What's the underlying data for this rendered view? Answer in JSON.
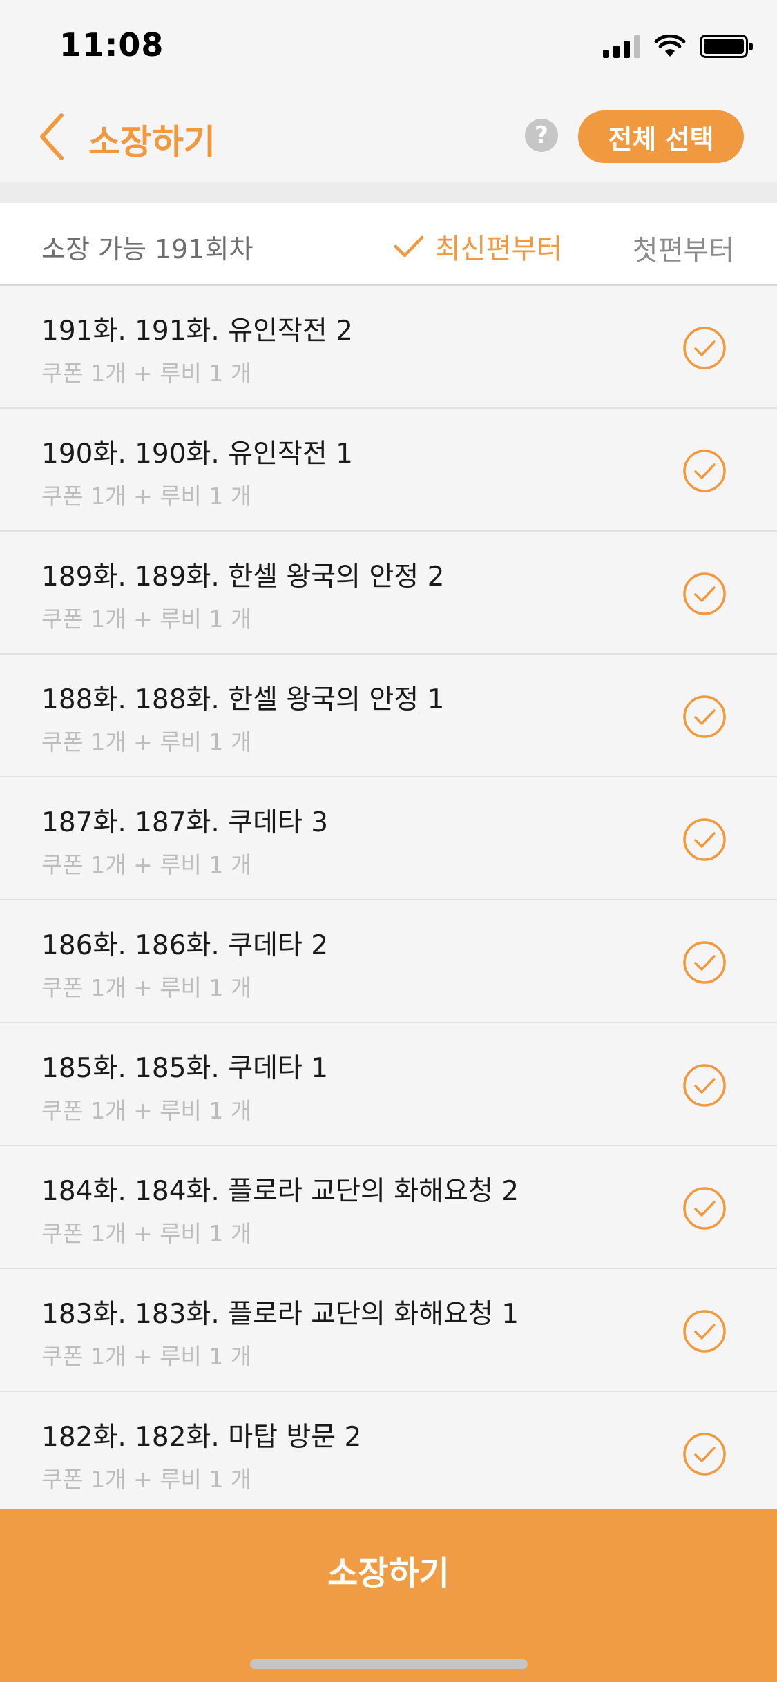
{
  "status_bar": {
    "time": "11:08"
  },
  "header": {
    "title": "소장하기",
    "help_label": "?",
    "select_all_label": "전체 선택",
    "accent_color": "#f0993e"
  },
  "sort": {
    "available_text": "소장 가능 191회차",
    "newest_label": "최신편부터",
    "oldest_label": "첫편부터",
    "selected": "newest"
  },
  "episodes": [
    {
      "title": "191화. 191화. 유인작전 2",
      "price": "쿠폰 1개 + 루비 1 개",
      "checked": true
    },
    {
      "title": "190화. 190화. 유인작전 1",
      "price": "쿠폰 1개 + 루비 1 개",
      "checked": true
    },
    {
      "title": "189화. 189화. 한셀 왕국의 안정 2",
      "price": "쿠폰 1개 + 루비 1 개",
      "checked": true
    },
    {
      "title": "188화. 188화. 한셀 왕국의 안정 1",
      "price": "쿠폰 1개 + 루비 1 개",
      "checked": true
    },
    {
      "title": "187화. 187화. 쿠데타 3",
      "price": "쿠폰 1개 + 루비 1 개",
      "checked": true
    },
    {
      "title": "186화. 186화. 쿠데타 2",
      "price": "쿠폰 1개 + 루비 1 개",
      "checked": true
    },
    {
      "title": "185화. 185화. 쿠데타 1",
      "price": "쿠폰 1개 + 루비 1 개",
      "checked": true
    },
    {
      "title": "184화. 184화. 플로라 교단의 화해요청 2",
      "price": "쿠폰 1개 + 루비 1 개",
      "checked": true
    },
    {
      "title": "183화. 183화. 플로라 교단의 화해요청 1",
      "price": "쿠폰 1개 + 루비 1 개",
      "checked": true
    },
    {
      "title": "182화. 182화. 마탑 방문 2",
      "price": "쿠폰 1개 + 루비 1 개",
      "checked": true
    }
  ],
  "footer": {
    "buy_label": "소장하기"
  }
}
